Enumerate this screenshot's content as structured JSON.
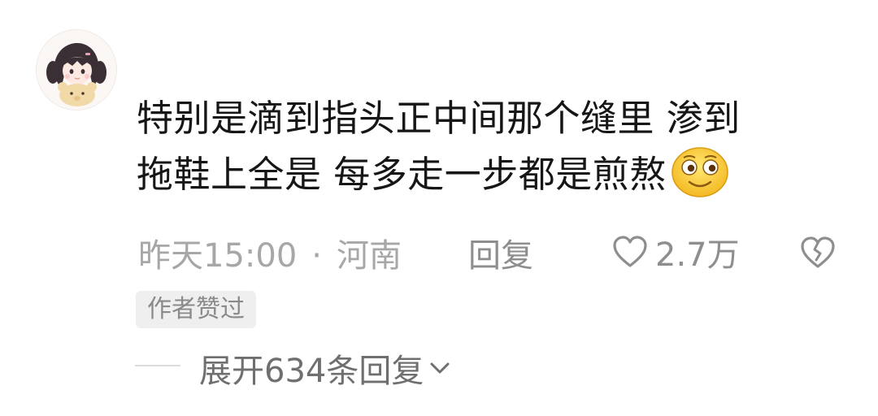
{
  "avatar": {
    "icon": "avatar-girl-with-bear"
  },
  "comment": {
    "line1": "特别是滴到指头正中间那个缝里 渗到",
    "line2": "拖鞋上全是 每多走一步都是煎熬",
    "emoji": "smiling-face-emoji"
  },
  "meta": {
    "time": "昨天15:00",
    "separator": "·",
    "location": "河南",
    "reply_label": "回复",
    "like_count": "2.7万",
    "like_icon": "heart-outline-icon",
    "dislike_icon": "broken-heart-icon"
  },
  "badge": {
    "label": "作者赞过"
  },
  "expand": {
    "label": "展开634条回复",
    "icon": "chevron-down-icon"
  },
  "colors": {
    "text_primary": "#161616",
    "text_meta": "#a7a7a7",
    "text_action": "#8e8e8e",
    "badge_bg": "#efefef"
  }
}
